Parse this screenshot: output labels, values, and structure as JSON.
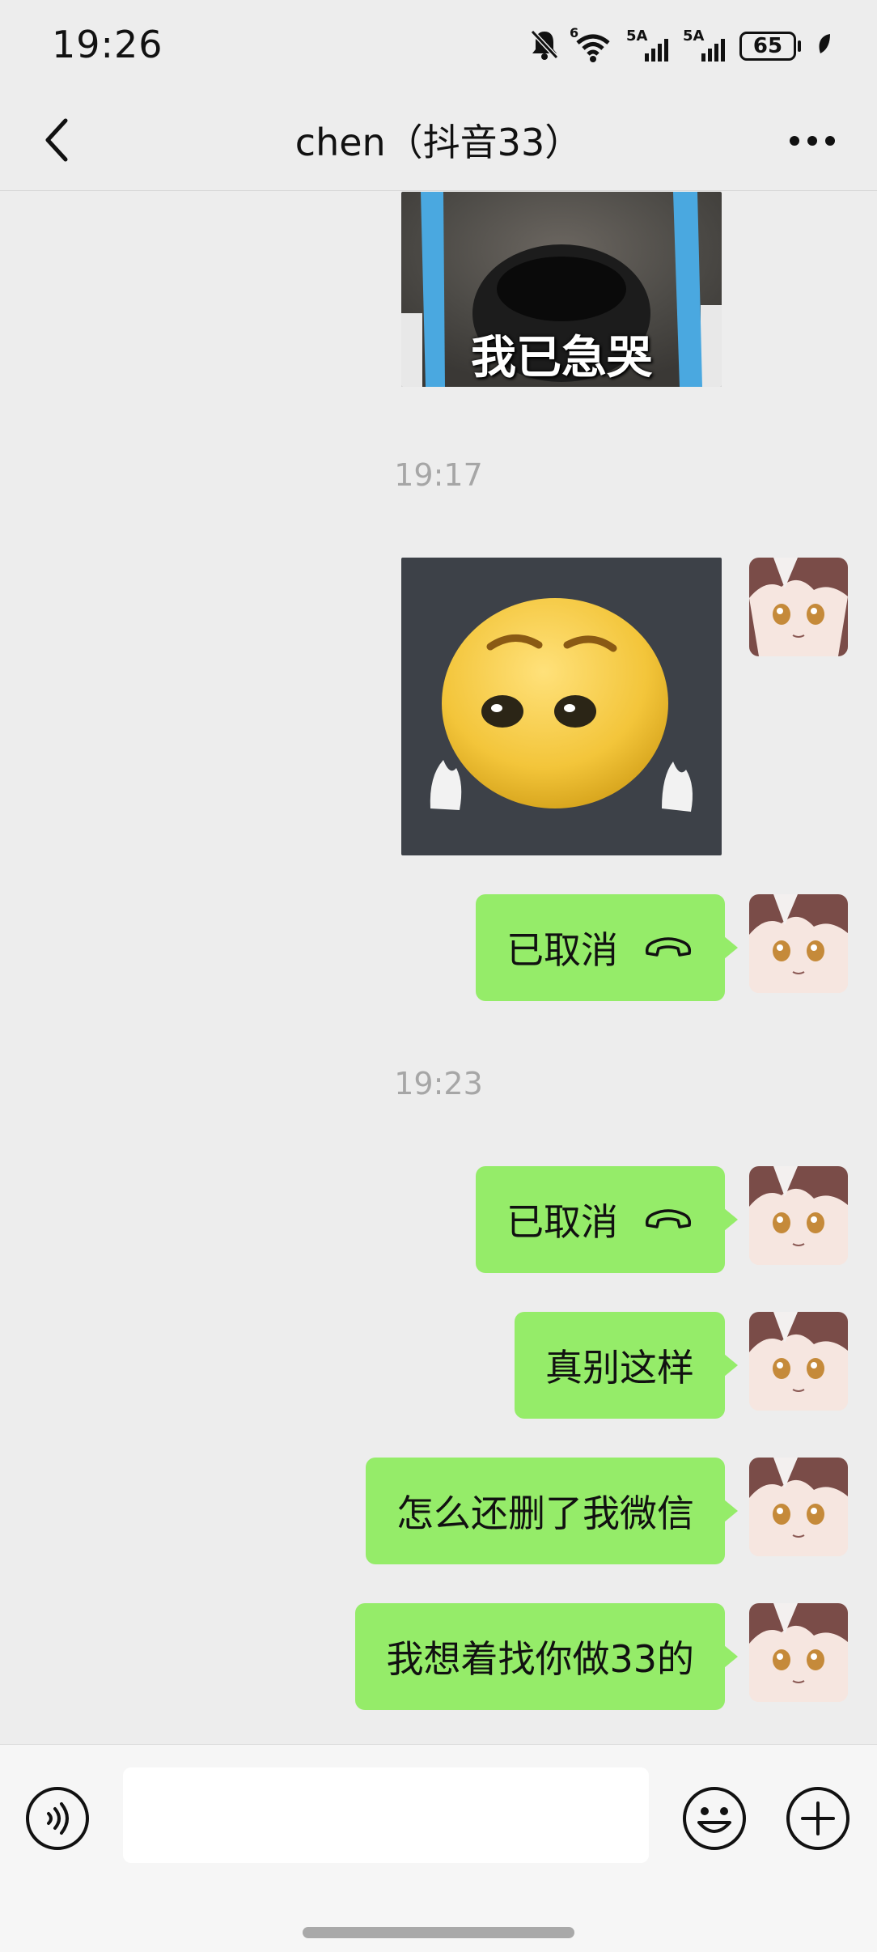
{
  "status_bar": {
    "time": "19:26",
    "signal_1_label": "5A",
    "signal_2_label": "5A",
    "wifi_label": "6",
    "battery": "65"
  },
  "header": {
    "title": "chen（抖音33）"
  },
  "messages": {
    "sticker_top_caption": "我已急哭",
    "timestamp_1": "19:17",
    "call_1": "已取消",
    "timestamp_2": "19:23",
    "call_2": "已取消",
    "text_1": "真别这样",
    "text_2": "怎么还删了我微信",
    "text_3": "我想着找你做33的"
  },
  "input": {
    "value": ""
  },
  "colors": {
    "background": "#ededed",
    "bubble": "#95ec69",
    "timestamp": "#a6a6a6"
  }
}
